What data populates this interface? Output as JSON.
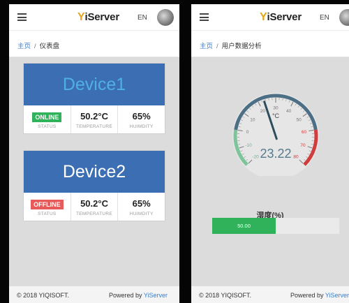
{
  "header": {
    "logo": "iServer",
    "logo_prefix": "Y",
    "lang": "EN"
  },
  "left": {
    "breadcrumb": {
      "home": "主页",
      "separator": "/",
      "current": "仪表盘"
    },
    "devices": [
      {
        "name": "Device1",
        "name_color": "#4fb0e6",
        "status": "ONLINE",
        "status_color": "#2fb25a",
        "temperature": "50.2°C",
        "humidity": "65%"
      },
      {
        "name": "Device2",
        "name_color": "#ffffff",
        "status": "OFFLINE",
        "status_color": "#e85a5a",
        "temperature": "50.2°C",
        "humidity": "65%"
      }
    ],
    "labels": {
      "status": "STATUS",
      "temperature": "TEMPERATURE",
      "humidity": "HUIMDITY"
    }
  },
  "right": {
    "breadcrumb": {
      "home": "主页",
      "separator": "/",
      "current": "用户数据分析"
    },
    "gauge": {
      "value": "23.22",
      "unit": "°C",
      "ticks": [
        "-20",
        "-10",
        "0",
        "10",
        "20",
        "30",
        "40",
        "50",
        "60",
        "70",
        "80"
      ],
      "value_num": 23.22
    },
    "humidity": {
      "title": "湿度(%)",
      "value_label": "50.00",
      "value": 50
    }
  },
  "footer": {
    "copyright": "© 2018 YIQISOFT.",
    "powered_prefix": "Powered by ",
    "powered_brand": "YiServer"
  },
  "colors": {
    "accent": "#3b6eb3",
    "link": "#3a7dc9",
    "online": "#2fb25a",
    "offline": "#e85a5a"
  }
}
